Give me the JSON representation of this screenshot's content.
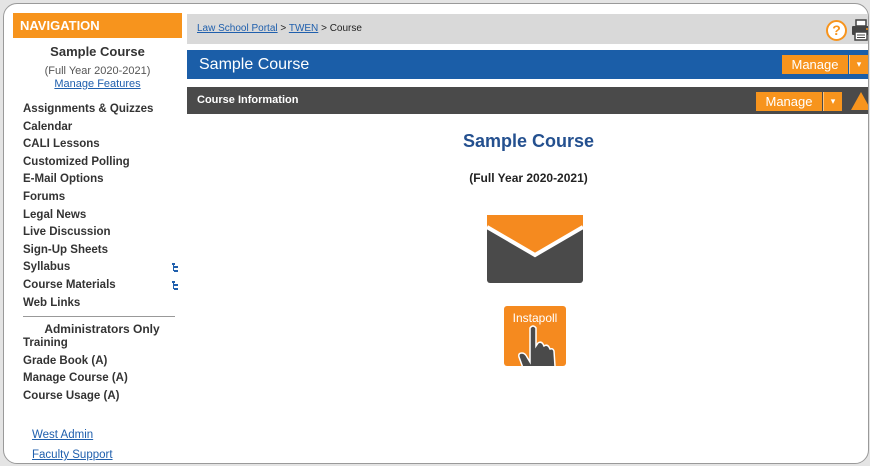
{
  "sidebar": {
    "header": "NAVIGATION",
    "course_name": "Sample Course",
    "course_term": "(Full Year 2020-2021)",
    "manage_features": "Manage Features",
    "items": [
      {
        "label": "Assignments & Quizzes"
      },
      {
        "label": "Calendar"
      },
      {
        "label": "CALI Lessons"
      },
      {
        "label": "Customized Polling"
      },
      {
        "label": "E-Mail Options"
      },
      {
        "label": "Forums"
      },
      {
        "label": "Legal News"
      },
      {
        "label": "Live Discussion"
      },
      {
        "label": "Sign-Up Sheets"
      },
      {
        "label": "Syllabus",
        "icon": "tree-icon"
      },
      {
        "label": "Course Materials",
        "icon": "tree-icon"
      },
      {
        "label": "Web Links"
      }
    ],
    "admin_header": "Administrators Only",
    "admin_items": [
      {
        "label": "Training"
      },
      {
        "label": "Grade Book (A)"
      },
      {
        "label": "Manage Course (A)"
      },
      {
        "label": "Course Usage (A)"
      }
    ],
    "links": [
      "West Admin",
      "Faculty Support"
    ]
  },
  "breadcrumb": {
    "items": [
      "Law School Portal",
      "TWEN",
      "Course"
    ],
    "separator": ">"
  },
  "toolbar": {
    "help_glyph": "?",
    "help_icon": "help-icon",
    "print_icon": "print-icon"
  },
  "title_bar": {
    "title": "Sample Course",
    "manage_label": "Manage",
    "caret": "▾"
  },
  "info_bar": {
    "title": "Course Information",
    "manage_label": "Manage",
    "caret": "▾",
    "warning_icon": "warning-icon"
  },
  "main": {
    "title": "Sample Course",
    "term": "(Full Year 2020-2021)",
    "mail_icon": "mail-icon",
    "instapoll_label": "Instapoll"
  },
  "colors": {
    "accent": "#f7941d",
    "title_bar": "#1b5ea8",
    "info_bar": "#4a4a4a",
    "breadcrumb_bar": "#d9d9d9",
    "course_title": "#24508f",
    "mail_dark": "#4a4a4a",
    "link": "#1f5fad"
  }
}
